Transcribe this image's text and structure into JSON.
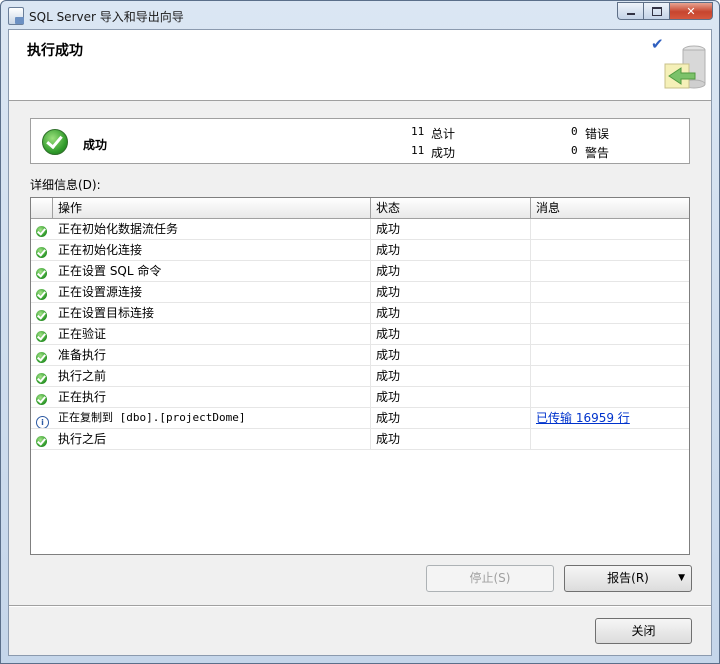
{
  "window": {
    "title": "SQL Server 导入和导出向导",
    "controls": [
      "minimize-icon",
      "maximize-icon",
      "close-icon"
    ]
  },
  "header": {
    "title": "执行成功"
  },
  "summary": {
    "status": "成功",
    "total_count": "11",
    "total_label": "总计",
    "success_count": "11",
    "success_label": "成功",
    "error_count": "0",
    "error_label": "错误",
    "warning_count": "0",
    "warning_label": "警告"
  },
  "details": {
    "label": "详细信息(D):",
    "columns": [
      "操作",
      "状态",
      "消息"
    ],
    "rows": [
      {
        "icon": "success-icon",
        "op": "正在初始化数据流任务",
        "status": "成功",
        "message": ""
      },
      {
        "icon": "success-icon",
        "op": "正在初始化连接",
        "status": "成功",
        "message": ""
      },
      {
        "icon": "success-icon",
        "op": "正在设置 SQL 命令",
        "status": "成功",
        "message": ""
      },
      {
        "icon": "success-icon",
        "op": "正在设置源连接",
        "status": "成功",
        "message": ""
      },
      {
        "icon": "success-icon",
        "op": "正在设置目标连接",
        "status": "成功",
        "message": ""
      },
      {
        "icon": "success-icon",
        "op": "正在验证",
        "status": "成功",
        "message": ""
      },
      {
        "icon": "success-icon",
        "op": "准备执行",
        "status": "成功",
        "message": ""
      },
      {
        "icon": "success-icon",
        "op": "执行之前",
        "status": "成功",
        "message": ""
      },
      {
        "icon": "success-icon",
        "op": "正在执行",
        "status": "成功",
        "message": ""
      },
      {
        "icon": "info-icon",
        "op": "正在复制到 [dbo].[projectDome]",
        "status": "成功",
        "message": "已传输 16959 行"
      },
      {
        "icon": "success-icon",
        "op": "执行之后",
        "status": "成功",
        "message": ""
      }
    ]
  },
  "buttons": {
    "stop": "停止(S)",
    "report": "报告(R)",
    "close": "关闭"
  },
  "colors": {
    "success": "#2f9a2a",
    "link": "#0033cc",
    "title_bar": "#c5d6ea"
  }
}
